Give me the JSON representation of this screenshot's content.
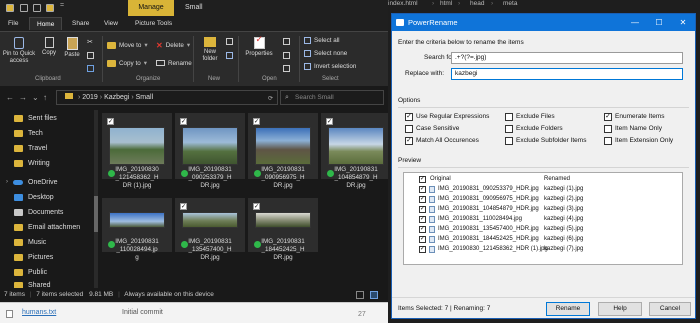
{
  "explorer": {
    "ribbon_tabs": {
      "file": "File",
      "home": "Home",
      "share": "Share",
      "view": "View",
      "picture_tools": "Picture Tools",
      "manage": "Manage"
    },
    "window_title": "Small",
    "clipboard": {
      "pin": "Pin to Quick\naccess",
      "copy": "Copy",
      "paste": "Paste",
      "label": "Clipboard"
    },
    "organize": {
      "move_to": "Move to",
      "copy_to": "Copy to",
      "delete": "Delete",
      "rename": "Rename",
      "label": "Organize"
    },
    "new": {
      "new_folder": "New\nfolder",
      "label": "New"
    },
    "open": {
      "properties": "Properties",
      "label": "Open"
    },
    "select": {
      "select_all": "Select all",
      "select_none": "Select none",
      "invert": "Invert selection",
      "label": "Select"
    },
    "breadcrumb": {
      "part1": "2019",
      "part2": "Kazbegi",
      "part3": "Small"
    },
    "search_placeholder": "Search Small",
    "sidebar": [
      "Sent files",
      "Tech",
      "Travel",
      "Writing",
      "OneDrive",
      "Desktop",
      "Documents",
      "Email attachmen",
      "Music",
      "Pictures",
      "Public",
      "Shared"
    ],
    "files": [
      {
        "l1": "IMG_20190830",
        "l2": "_121458362_H",
        "l3": "DR (1).jpg"
      },
      {
        "l1": "IMG_20190831",
        "l2": "_090253379_H",
        "l3": "DR.jpg"
      },
      {
        "l1": "IMG_20190831",
        "l2": "_090956975_H",
        "l3": "DR.jpg"
      },
      {
        "l1": "IMG_20190831",
        "l2": "_104854879_H",
        "l3": "DR.jpg"
      },
      {
        "l1": "IMG_20190831",
        "l2": "_110028494.jp",
        "l3": "g"
      },
      {
        "l1": "IMG_20190831",
        "l2": "_135457400_H",
        "l3": "DR.jpg"
      },
      {
        "l1": "IMG_20190831",
        "l2": "_184452425_H",
        "l3": "DR.jpg"
      }
    ],
    "status": {
      "items": "7 items",
      "selected": "7 items selected",
      "size": "9.81 MB",
      "availability": "Always available on this device"
    },
    "bottom": {
      "file": "humans.txt",
      "commit": "Initial commit"
    }
  },
  "vscode": {
    "tab1": "index.html",
    "tab2": "html",
    "tab3": "head",
    "tab4": "meta",
    "line_no": "27"
  },
  "dialog": {
    "title": "PowerRename",
    "criteria_label": "Enter the criteria below to rename the items",
    "search_label": "Search for:",
    "search_value": ".+?(?=.jpg)",
    "replace_label": "Replace with:",
    "replace_value": "kazbegi",
    "options_label": "Options",
    "options": {
      "regex": "Use Regular Expressions",
      "case": "Case Sensitive",
      "match_all": "Match All Occurences",
      "exclude_files": "Exclude Files",
      "exclude_folders": "Exclude Folders",
      "exclude_subfolder": "Exclude Subfolder Items",
      "enumerate": "Enumerate Items",
      "item_name_only": "Item Name Only",
      "item_ext_only": "Item Extension Only"
    },
    "preview_label": "Preview",
    "col_original": "Original",
    "col_renamed": "Renamed",
    "rows": [
      {
        "orig": "IMG_20190831_090253379_HDR.jpg",
        "ren": "kazbegi (1).jpg"
      },
      {
        "orig": "IMG_20190831_090956975_HDR.jpg",
        "ren": "kazbegi (2).jpg"
      },
      {
        "orig": "IMG_20190831_104854879_HDR.jpg",
        "ren": "kazbegi (3).jpg"
      },
      {
        "orig": "IMG_20190831_110028494.jpg",
        "ren": "kazbegi (4).jpg"
      },
      {
        "orig": "IMG_20190831_135457400_HDR.jpg",
        "ren": "kazbegi (5).jpg"
      },
      {
        "orig": "IMG_20190831_184452425_HDR.jpg",
        "ren": "kazbegi (6).jpg"
      },
      {
        "orig": "IMG_20190830_121458362_HDR (1).jpg",
        "ren": "kazbegi (7).jpg"
      }
    ],
    "status": "Items Selected: 7 | Renaming: 7",
    "buttons": {
      "rename": "Rename",
      "help": "Help",
      "cancel": "Cancel"
    }
  }
}
